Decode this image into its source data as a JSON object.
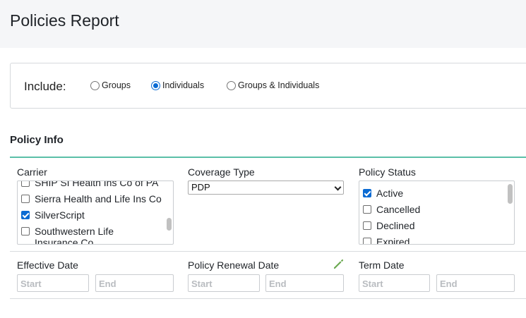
{
  "page": {
    "title": "Policies Report"
  },
  "include": {
    "label": "Include:",
    "options": [
      {
        "label": "Groups",
        "selected": false
      },
      {
        "label": "Individuals",
        "selected": true
      },
      {
        "label": "Groups & Individuals",
        "selected": false
      }
    ]
  },
  "policy_info": {
    "title": "Policy Info",
    "carrier": {
      "label": "Carrier",
      "items": [
        {
          "label": "SHIP SI Health Ins Co of PA",
          "checked": false
        },
        {
          "label": "Sierra Health and Life Ins Co",
          "checked": false
        },
        {
          "label": "SilverScript",
          "checked": true
        },
        {
          "label": "Southwestern Life Insurance Co",
          "checked": false
        }
      ]
    },
    "coverage_type": {
      "label": "Coverage Type",
      "value": "PDP"
    },
    "policy_status": {
      "label": "Policy Status",
      "items": [
        {
          "label": "Active",
          "checked": true
        },
        {
          "label": "Cancelled",
          "checked": false
        },
        {
          "label": "Declined",
          "checked": false
        },
        {
          "label": "Expired",
          "checked": false
        }
      ]
    },
    "effective_date": {
      "label": "Effective Date",
      "start_placeholder": "Start",
      "end_placeholder": "End"
    },
    "renewal_date": {
      "label": "Policy Renewal Date",
      "start_placeholder": "Start",
      "end_placeholder": "End"
    },
    "term_date": {
      "label": "Term Date",
      "start_placeholder": "Start",
      "end_placeholder": "End"
    }
  },
  "colors": {
    "accent": "#0b6bd3",
    "section_rule": "#5bbfa8",
    "pencil": "#6aa84f"
  },
  "icons": {
    "edit": "pencil-icon"
  }
}
